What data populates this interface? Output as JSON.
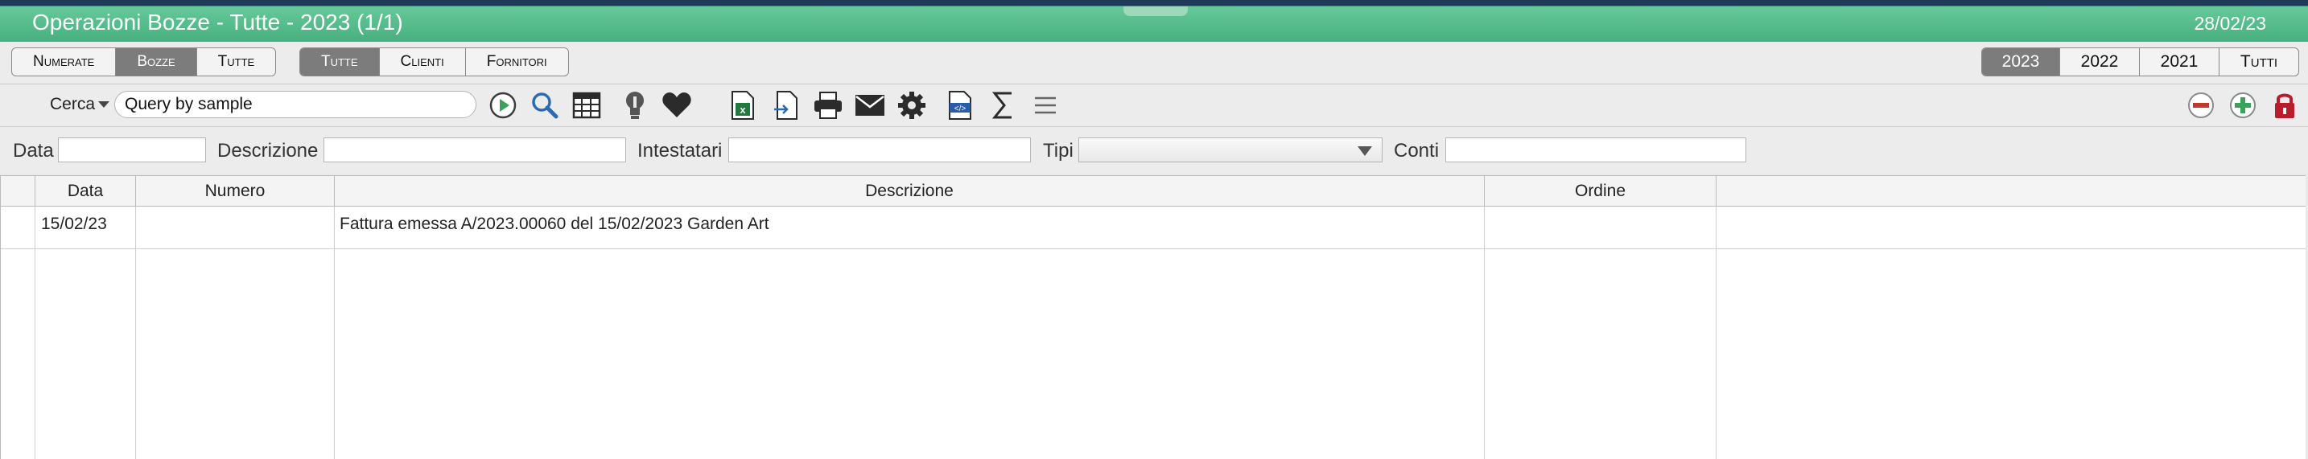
{
  "header": {
    "title": "Operazioni Bozze - Tutte - 2023 (1/1)",
    "date": "28/02/23"
  },
  "status_tabs": {
    "items": [
      {
        "label": "Numerate"
      },
      {
        "label": "Bozze",
        "selected": true
      },
      {
        "label": "Tutte"
      }
    ]
  },
  "party_tabs": {
    "items": [
      {
        "label": "Tutte",
        "selected": true
      },
      {
        "label": "Clienti"
      },
      {
        "label": "Fornitori"
      }
    ]
  },
  "year_tabs": {
    "items": [
      {
        "label": "2023",
        "selected": true
      },
      {
        "label": "2022"
      },
      {
        "label": "2021"
      },
      {
        "label": "Tutti"
      }
    ]
  },
  "toolbar": {
    "cerca_label": "Cerca",
    "search_value": "Query by sample",
    "icons": [
      "run-icon",
      "search-icon",
      "table-icon",
      "lightbulb-icon",
      "heart-icon",
      "excel-export-icon",
      "import-icon",
      "print-icon",
      "mail-icon",
      "gear-icon",
      "xml-icon",
      "sum-icon",
      "menu-icon"
    ],
    "right_icons": [
      "remove-icon",
      "add-icon",
      "lock-icon"
    ]
  },
  "filters": {
    "data": "Data",
    "descrizione": "Descrizione",
    "intestatari": "Intestatari",
    "tipi": "Tipi",
    "conti": "Conti"
  },
  "table": {
    "columns": [
      "Data",
      "Numero",
      "Descrizione",
      "Ordine"
    ],
    "rows": [
      {
        "data": "15/02/23",
        "numero": "",
        "descrizione": "Fattura emessa A/2023.00060 del 15/02/2023 Garden Art",
        "ordine": ""
      }
    ]
  },
  "colors": {
    "header_green": "#47b07f",
    "selected_tab": "#7c7c7c",
    "heart": "#2b2b2b",
    "excel": "#1f7a3e",
    "remove_red": "#c0392b",
    "add_green": "#3aa35a",
    "lock": "#b81d2b"
  }
}
